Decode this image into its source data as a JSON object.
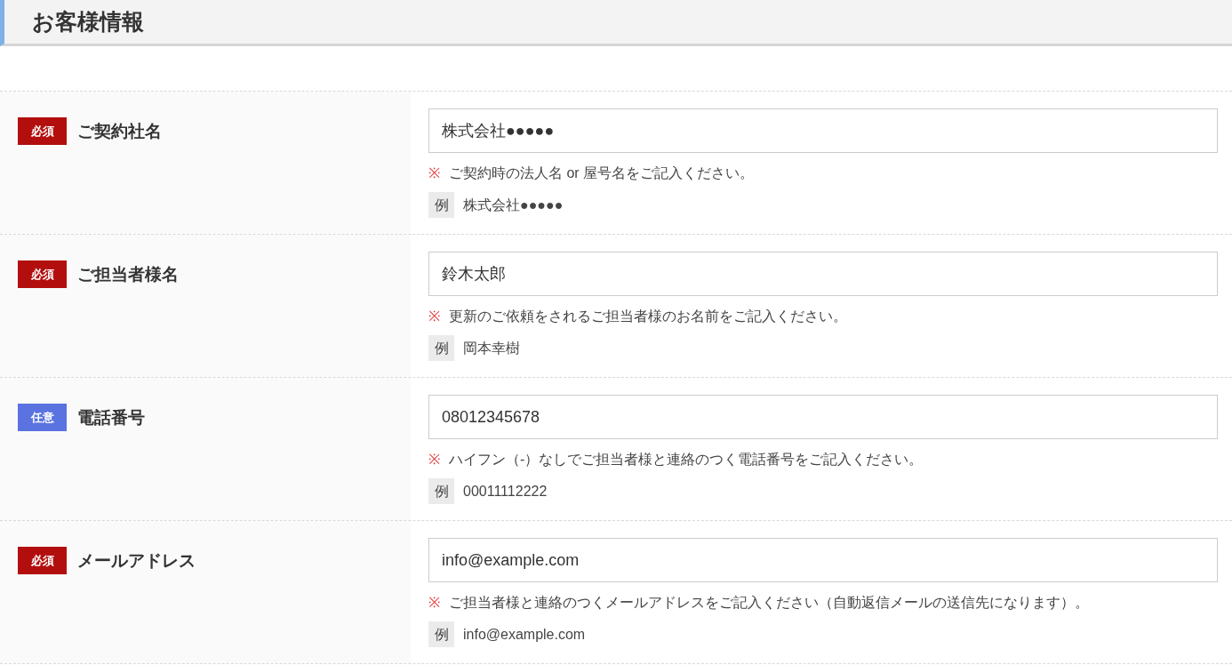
{
  "section_title": "お客様情報",
  "fields": [
    {
      "badge": {
        "kind": "required",
        "label": "必須"
      },
      "label": "ご契約社名",
      "value": "株式会社●●●●●",
      "note_mark": "※",
      "note": "ご契約時の法人名 or 屋号名をご記入ください。",
      "example_label": "例",
      "example": "株式会社●●●●●"
    },
    {
      "badge": {
        "kind": "required",
        "label": "必須"
      },
      "label": "ご担当者様名",
      "value": "鈴木太郎",
      "note_mark": "※",
      "note": "更新のご依頼をされるご担当者様のお名前をご記入ください。",
      "example_label": "例",
      "example": "岡本幸樹"
    },
    {
      "badge": {
        "kind": "optional",
        "label": "任意"
      },
      "label": "電話番号",
      "value": "08012345678",
      "note_mark": "※",
      "note": "ハイフン（-）なしでご担当者様と連絡のつく電話番号をご記入ください。",
      "example_label": "例",
      "example": "00011112222"
    },
    {
      "badge": {
        "kind": "required",
        "label": "必須"
      },
      "label": "メールアドレス",
      "value": "info@example.com",
      "note_mark": "※",
      "note": "ご担当者様と連絡のつくメールアドレスをご記入ください（自動返信メールの送信先になります）。",
      "example_label": "例",
      "example": "info@example.com"
    }
  ]
}
